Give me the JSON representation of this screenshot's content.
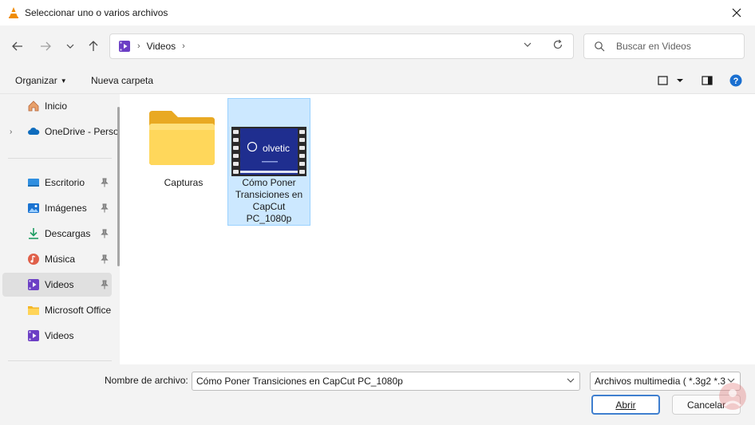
{
  "window": {
    "title": "Seleccionar uno o varios archivos",
    "close_icon": "close-icon"
  },
  "nav": {
    "back_icon": "back-arrow-icon",
    "forward_icon": "forward-arrow-icon",
    "recent_icon": "chevron-down-icon",
    "up_icon": "up-arrow-icon",
    "breadcrumb": [
      "Videos"
    ],
    "refresh_icon": "refresh-icon",
    "search_placeholder": "Buscar en Videos"
  },
  "toolbar": {
    "organize_label": "Organizar",
    "new_folder_label": "Nueva carpeta",
    "view_icon": "view-layout-icon",
    "preview_pane_icon": "preview-pane-icon",
    "help_icon": "help-icon"
  },
  "sidebar": {
    "items": [
      {
        "label": "Inicio",
        "icon": "home-icon",
        "expandable": false,
        "pinned": false,
        "active": false
      },
      {
        "label": "OneDrive - Perso",
        "icon": "onedrive-icon",
        "expandable": true,
        "pinned": false,
        "active": false
      },
      {
        "label": "Escritorio",
        "icon": "desktop-icon",
        "expandable": false,
        "pinned": true,
        "active": false
      },
      {
        "label": "Imágenes",
        "icon": "pictures-icon",
        "expandable": false,
        "pinned": true,
        "active": false
      },
      {
        "label": "Descargas",
        "icon": "downloads-icon",
        "expandable": false,
        "pinned": true,
        "active": false
      },
      {
        "label": "Música",
        "icon": "music-icon",
        "expandable": false,
        "pinned": true,
        "active": false
      },
      {
        "label": "Videos",
        "icon": "videos-icon",
        "expandable": false,
        "pinned": true,
        "active": true
      },
      {
        "label": "Microsoft Office",
        "icon": "folder-icon",
        "expandable": false,
        "pinned": false,
        "active": false
      },
      {
        "label": "Videos",
        "icon": "videos-icon",
        "expandable": false,
        "pinned": false,
        "active": false
      }
    ]
  },
  "files": [
    {
      "name": "Capturas",
      "type": "folder",
      "selected": false
    },
    {
      "name": "Cómo Poner Transiciones en CapCut PC_1080p",
      "type": "video",
      "thumbnail_text": "olvetic",
      "selected": true
    }
  ],
  "footer": {
    "filename_label": "Nombre de archivo:",
    "filename_value": "Cómo Poner Transiciones en CapCut PC_1080p",
    "filter_value": "Archivos multimedia ( *.3g2 *.3",
    "open_label": "Abrir",
    "cancel_label": "Cancelar"
  },
  "colors": {
    "accent": "#3f7fcf",
    "selection": "#cce8ff",
    "folder": "#f8c543",
    "video_thumb": "#1f2e8f"
  }
}
